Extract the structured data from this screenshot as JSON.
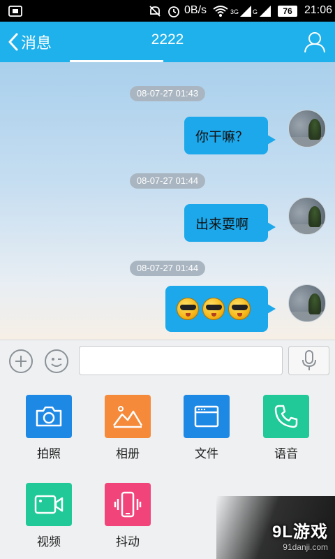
{
  "status_bar": {
    "network_speed": "0B/s",
    "signal_3g": "3G",
    "signal_g": "G",
    "battery": "76",
    "time": "21:06",
    "icons": [
      "screenshot-icon",
      "notification-off-icon",
      "alarm-icon",
      "wifi-icon",
      "signal-icon",
      "battery-icon"
    ]
  },
  "header": {
    "back_label": "消息",
    "title": "2222",
    "profile_icon": "person-icon",
    "color": "#1fb1ec"
  },
  "messages": [
    {
      "timestamp": "08-07-27 01:43",
      "text": "你干嘛？",
      "type": "text"
    },
    {
      "timestamp": "08-07-27 01:44",
      "text": "出来耍啊",
      "type": "text"
    },
    {
      "timestamp": "08-07-27 01:44",
      "type": "emoji",
      "emoji": [
        "cool-face-emoji",
        "cool-face-emoji",
        "cool-face-emoji"
      ]
    }
  ],
  "input": {
    "value": "",
    "placeholder": ""
  },
  "tools": [
    {
      "label": "拍照",
      "icon": "camera-icon",
      "color": "#1e88e5"
    },
    {
      "label": "相册",
      "icon": "photo-album-icon",
      "color": "#f58a3a"
    },
    {
      "label": "文件",
      "icon": "file-icon",
      "color": "#1e88e5"
    },
    {
      "label": "语音",
      "icon": "phone-icon",
      "color": "#20c997"
    },
    {
      "label": "视频",
      "icon": "video-camera-icon",
      "color": "#20c997"
    },
    {
      "label": "抖动",
      "icon": "shake-phone-icon",
      "color": "#f0447a"
    }
  ],
  "watermark": {
    "brand": "9L游戏",
    "site": "91danji.com"
  }
}
